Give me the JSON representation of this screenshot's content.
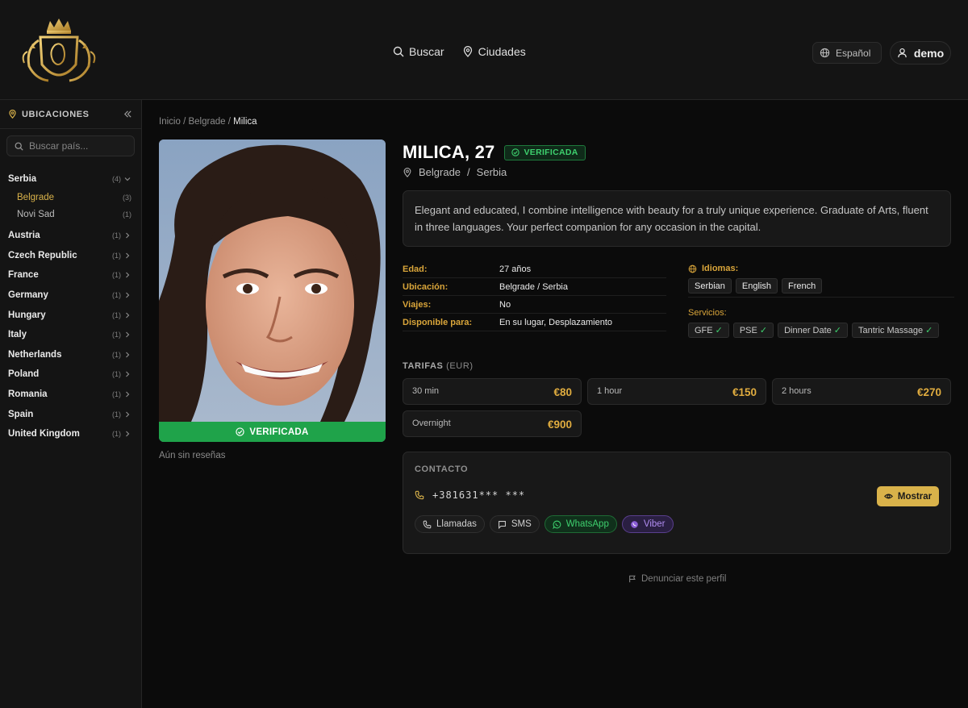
{
  "header": {
    "nav": [
      {
        "label": "Buscar",
        "icon": "search-icon"
      },
      {
        "label": "Ciudades",
        "icon": "map-pin-icon"
      }
    ],
    "language": "Español",
    "user": "demo"
  },
  "sidebar": {
    "title": "UBICACIONES",
    "search_placeholder": "Buscar país...",
    "countries": [
      {
        "name": "Serbia",
        "count": "(4)",
        "expanded": true,
        "cities": [
          {
            "name": "Belgrade",
            "count": "(3)",
            "active": true
          },
          {
            "name": "Novi Sad",
            "count": "(1)",
            "active": false
          }
        ]
      },
      {
        "name": "Austria",
        "count": "(1)"
      },
      {
        "name": "Czech Republic",
        "count": "(1)"
      },
      {
        "name": "France",
        "count": "(1)"
      },
      {
        "name": "Germany",
        "count": "(1)"
      },
      {
        "name": "Hungary",
        "count": "(1)"
      },
      {
        "name": "Italy",
        "count": "(1)"
      },
      {
        "name": "Netherlands",
        "count": "(1)"
      },
      {
        "name": "Poland",
        "count": "(1)"
      },
      {
        "name": "Romania",
        "count": "(1)"
      },
      {
        "name": "Spain",
        "count": "(1)"
      },
      {
        "name": "United Kingdom",
        "count": "(1)"
      }
    ]
  },
  "breadcrumb": {
    "home": "Inicio",
    "sep": "/",
    "city": "Belgrade",
    "current": "Milica"
  },
  "profile": {
    "name": "MILICA, 27",
    "verified_label": "VERIFICADA",
    "city": "Belgrade",
    "country": "Serbia",
    "location_sep": "/",
    "bio": "Elegant and educated, I combine intelligence with beauty for a truly unique experience. Graduate of Arts, fluent in three languages. Your perfect companion for any occasion in the capital.",
    "photo_badge": "VERIFICADA",
    "reviews": "Aún sin reseñas",
    "details": [
      {
        "key": "Edad:",
        "value": "27 años"
      },
      {
        "key": "Ubicación:",
        "value": "Belgrade / Serbia"
      },
      {
        "key": "Viajes:",
        "value": "No"
      },
      {
        "key": "Disponible para:",
        "value": "En su lugar, Desplazamiento"
      }
    ],
    "languages_label": "Idiomas:",
    "languages": [
      "Serbian",
      "English",
      "French"
    ],
    "services_label": "Servicios:",
    "services": [
      "GFE",
      "PSE",
      "Dinner Date",
      "Tantric Massage"
    ],
    "check": "✓"
  },
  "rates": {
    "label": "TARIFAS",
    "currency": "(EUR)",
    "items": [
      {
        "duration": "30 min",
        "price": "€80"
      },
      {
        "duration": "1 hour",
        "price": "€150"
      },
      {
        "duration": "2 hours",
        "price": "€270"
      },
      {
        "duration": "Overnight",
        "price": "€900"
      }
    ]
  },
  "contact": {
    "title": "CONTACTO",
    "phone": "+381631*** ***",
    "show_label": "Mostrar",
    "methods": [
      {
        "label": "Llamadas",
        "icon": "phone-icon"
      },
      {
        "label": "SMS",
        "icon": "message-icon"
      },
      {
        "label": "WhatsApp",
        "icon": "whatsapp-icon"
      },
      {
        "label": "Viber",
        "icon": "viber-icon"
      }
    ]
  },
  "report_label": "Denunciar este perfil",
  "colors": {
    "accent": "#d9b24a",
    "verified": "#1fa34a",
    "whatsapp": "#3ed06e",
    "viber": "#b08cf0"
  }
}
